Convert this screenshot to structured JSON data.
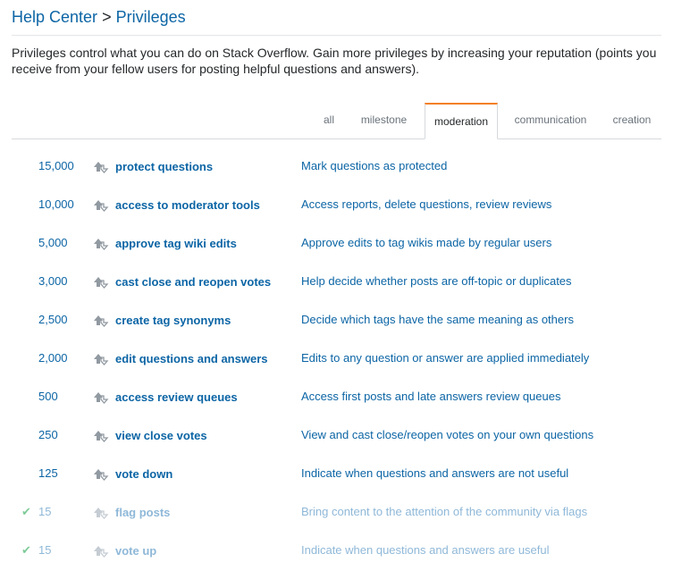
{
  "breadcrumb": {
    "home": "Help Center",
    "separator": ">",
    "current": "Privileges"
  },
  "intro": "Privileges control what you can do on Stack Overflow. Gain more privileges by increasing your reputation (points you receive from your fellow users for posting helpful questions and answers).",
  "tabs": [
    {
      "label": "all",
      "active": false
    },
    {
      "label": "milestone",
      "active": false
    },
    {
      "label": "moderation",
      "active": true
    },
    {
      "label": "communication",
      "active": false
    },
    {
      "label": "creation",
      "active": false
    }
  ],
  "privileges": [
    {
      "rep": "15,000",
      "name": "protect questions",
      "desc": "Mark questions as protected",
      "earned": false
    },
    {
      "rep": "10,000",
      "name": "access to moderator tools",
      "desc": "Access reports, delete questions, review reviews",
      "earned": false
    },
    {
      "rep": "5,000",
      "name": "approve tag wiki edits",
      "desc": "Approve edits to tag wikis made by regular users",
      "earned": false
    },
    {
      "rep": "3,000",
      "name": "cast close and reopen votes",
      "desc": "Help decide whether posts are off-topic or duplicates",
      "earned": false
    },
    {
      "rep": "2,500",
      "name": "create tag synonyms",
      "desc": "Decide which tags have the same meaning as others",
      "earned": false
    },
    {
      "rep": "2,000",
      "name": "edit questions and answers",
      "desc": "Edits to any question or answer are applied immediately",
      "earned": false
    },
    {
      "rep": "500",
      "name": "access review queues",
      "desc": "Access first posts and late answers review queues",
      "earned": false
    },
    {
      "rep": "250",
      "name": "view close votes",
      "desc": "View and cast close/reopen votes on your own questions",
      "earned": false
    },
    {
      "rep": "125",
      "name": "vote down",
      "desc": "Indicate when questions and answers are not useful",
      "earned": false
    },
    {
      "rep": "15",
      "name": "flag posts",
      "desc": "Bring content to the attention of the community via flags",
      "earned": true
    },
    {
      "rep": "15",
      "name": "vote up",
      "desc": "Indicate when questions and answers are useful",
      "earned": true
    }
  ],
  "icons": {
    "earned": "checkmark-icon",
    "privilege": "privilege-arrows-icon"
  },
  "colors": {
    "link": "#0c65a5",
    "earned_text": "#8fb8d8",
    "check": "#7fcb99",
    "tab_accent": "#f48024"
  }
}
